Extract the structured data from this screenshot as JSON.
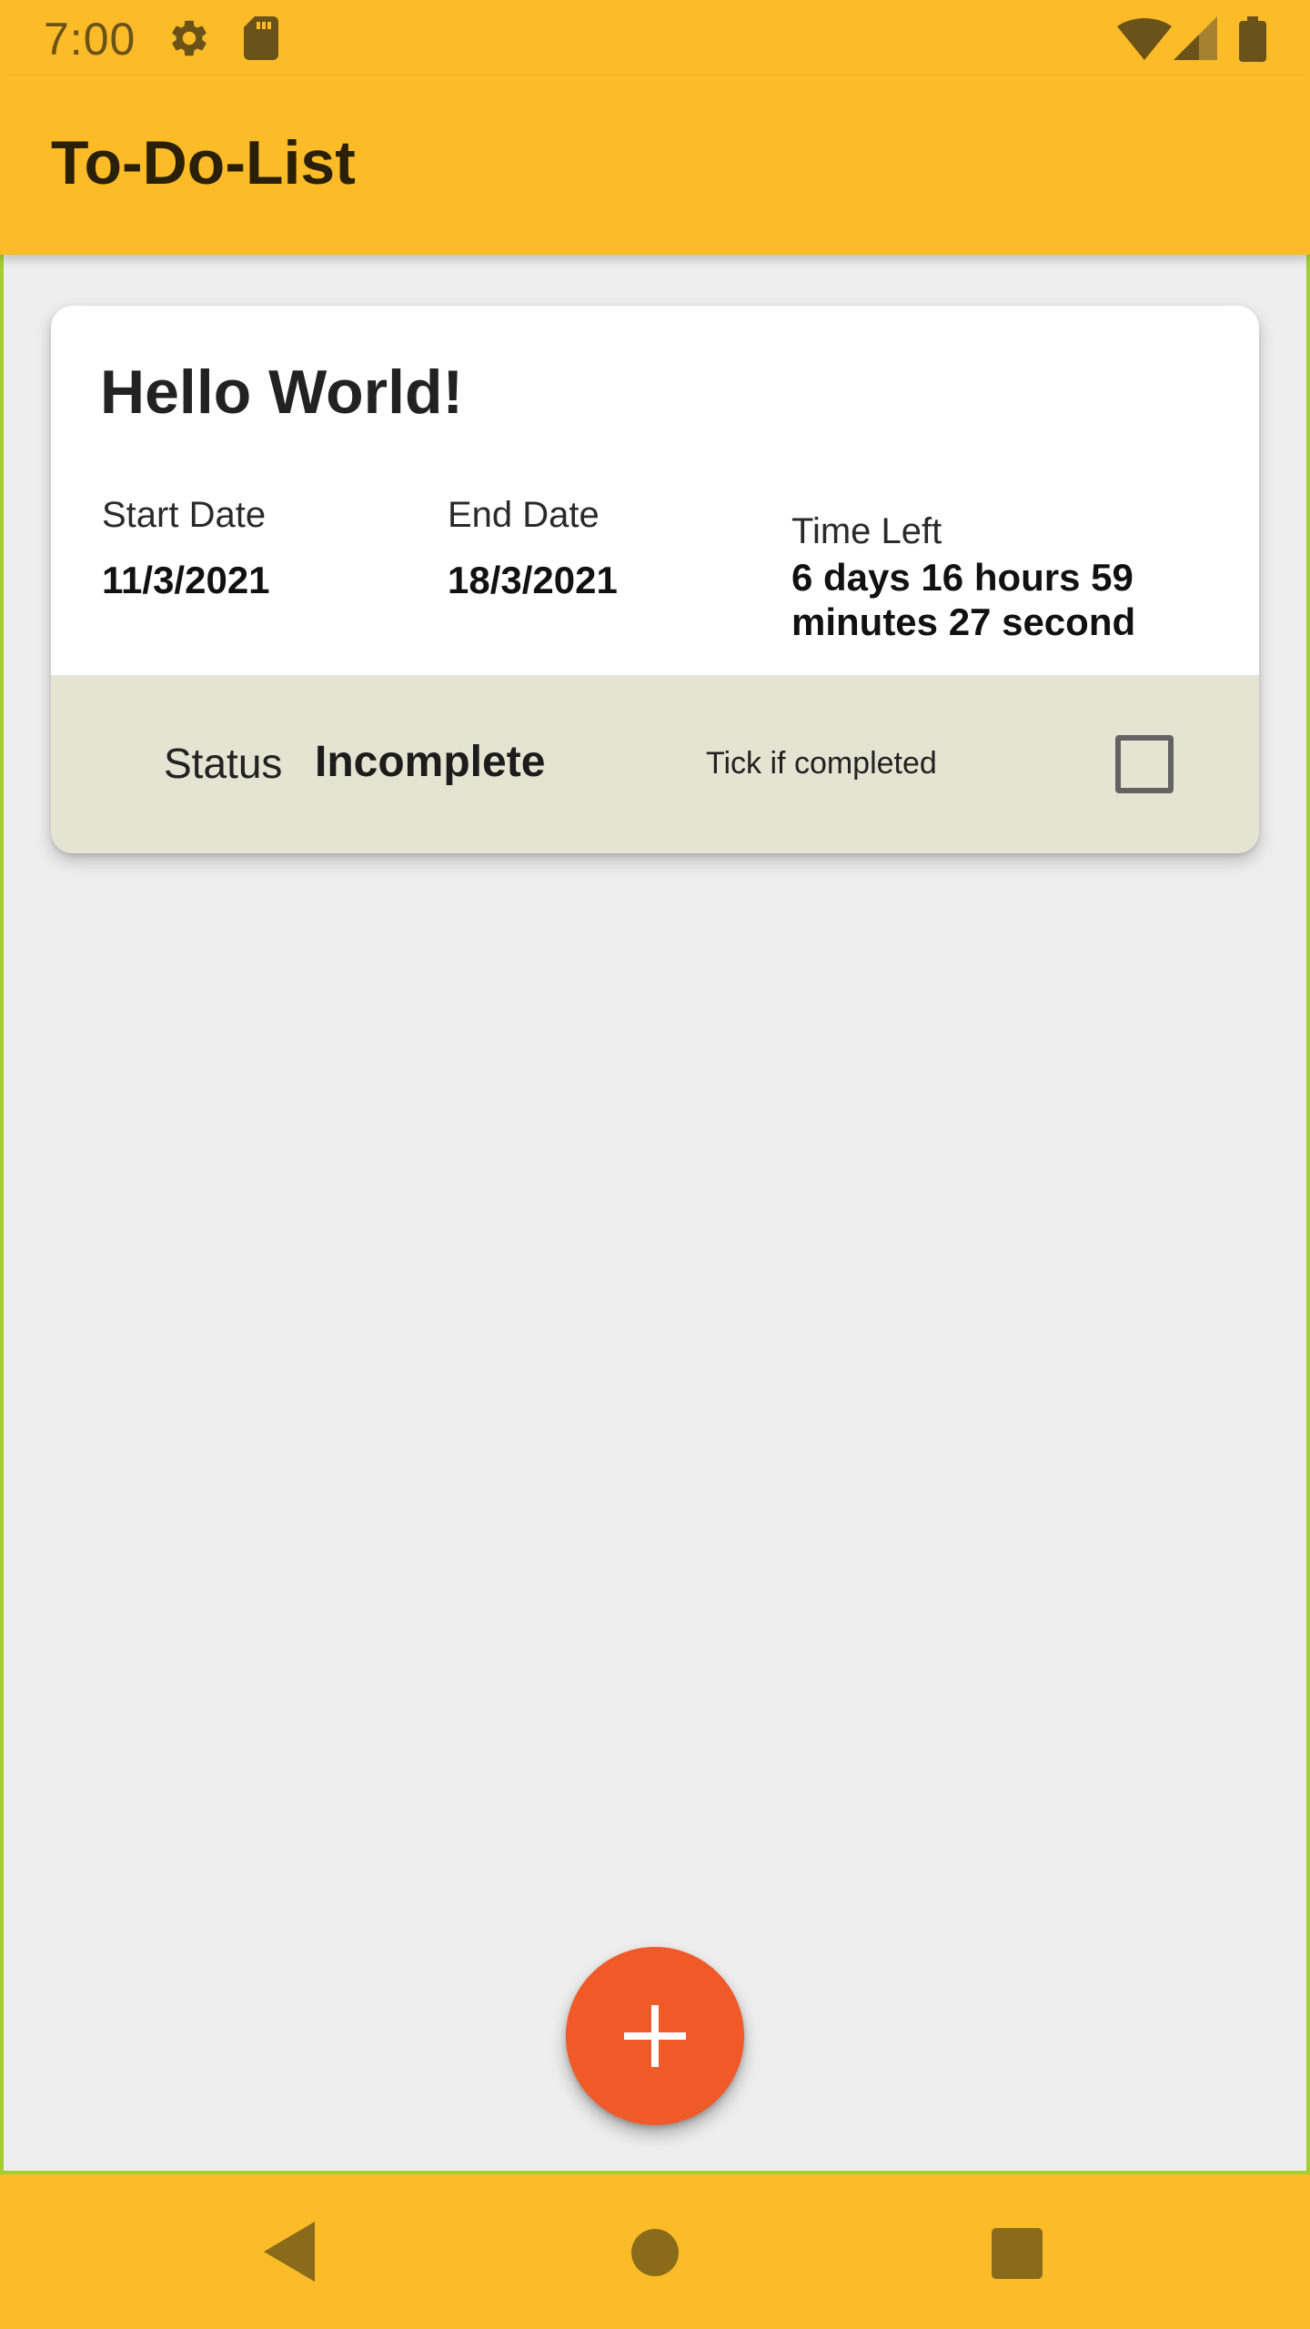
{
  "status_bar": {
    "time": "7:00",
    "icons": [
      "gear-icon",
      "sd-card-icon",
      "wifi-icon",
      "signal-icon",
      "battery-icon"
    ]
  },
  "app_bar": {
    "title": "To-Do-List"
  },
  "task": {
    "title": "Hello World!",
    "start_date_label": "Start Date",
    "start_date": "11/3/2021",
    "end_date_label": "End Date",
    "end_date": "18/3/2021",
    "time_left_label": "Time Left",
    "time_left": "6 days 16 hours 59 minutes 27 second",
    "status_label": "Status",
    "status_value": "Incomplete",
    "tick_label": "Tick if completed",
    "completed": false
  },
  "fab": {
    "icon": "plus-icon"
  },
  "nav_bar": {
    "icons": [
      "back-icon",
      "home-icon",
      "recents-icon"
    ]
  },
  "colors": {
    "accent": "#fcbc28",
    "fab": "#f05a28",
    "background": "#eeeeee",
    "card_footer": "#e5e3d1",
    "frame": "#a4cf32"
  }
}
